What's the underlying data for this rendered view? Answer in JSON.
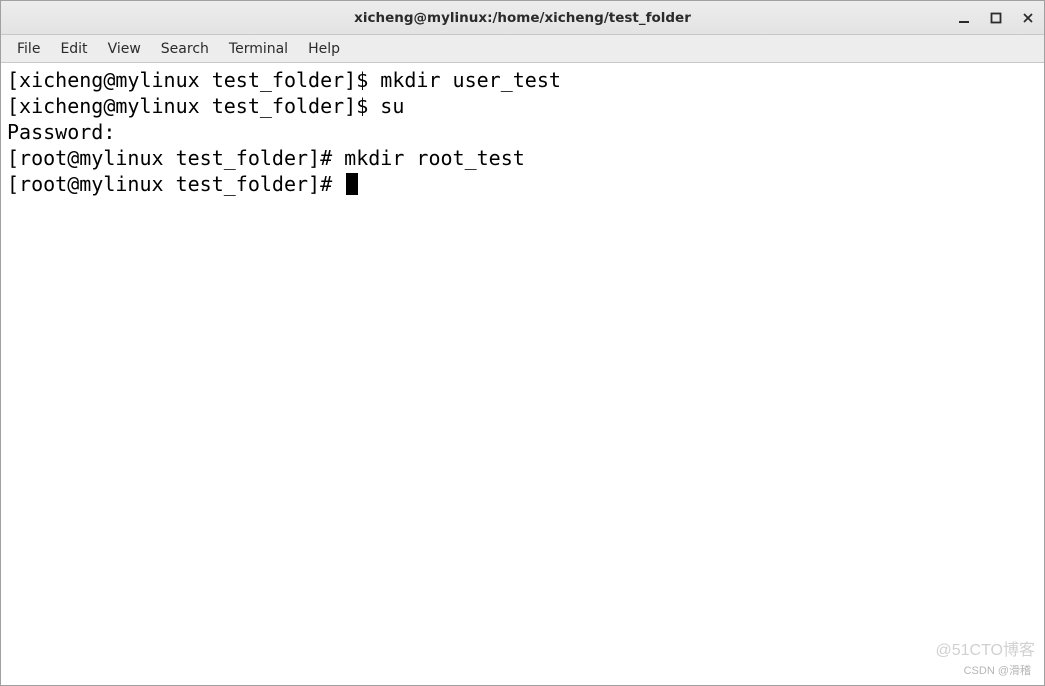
{
  "window": {
    "title": "xicheng@mylinux:/home/xicheng/test_folder"
  },
  "menubar": {
    "items": [
      "File",
      "Edit",
      "View",
      "Search",
      "Terminal",
      "Help"
    ]
  },
  "terminal": {
    "lines": [
      {
        "prompt": "[xicheng@mylinux test_folder]$ ",
        "command": "mkdir user_test"
      },
      {
        "prompt": "[xicheng@mylinux test_folder]$ ",
        "command": "su"
      },
      {
        "prompt": "",
        "command": "Password:"
      },
      {
        "prompt": "[root@mylinux test_folder]# ",
        "command": "mkdir root_test"
      },
      {
        "prompt": "[root@mylinux test_folder]# ",
        "command": "",
        "cursor": true
      }
    ]
  },
  "watermarks": {
    "w1": "@51CTO博客",
    "w2": "CSDN @滑稽"
  }
}
